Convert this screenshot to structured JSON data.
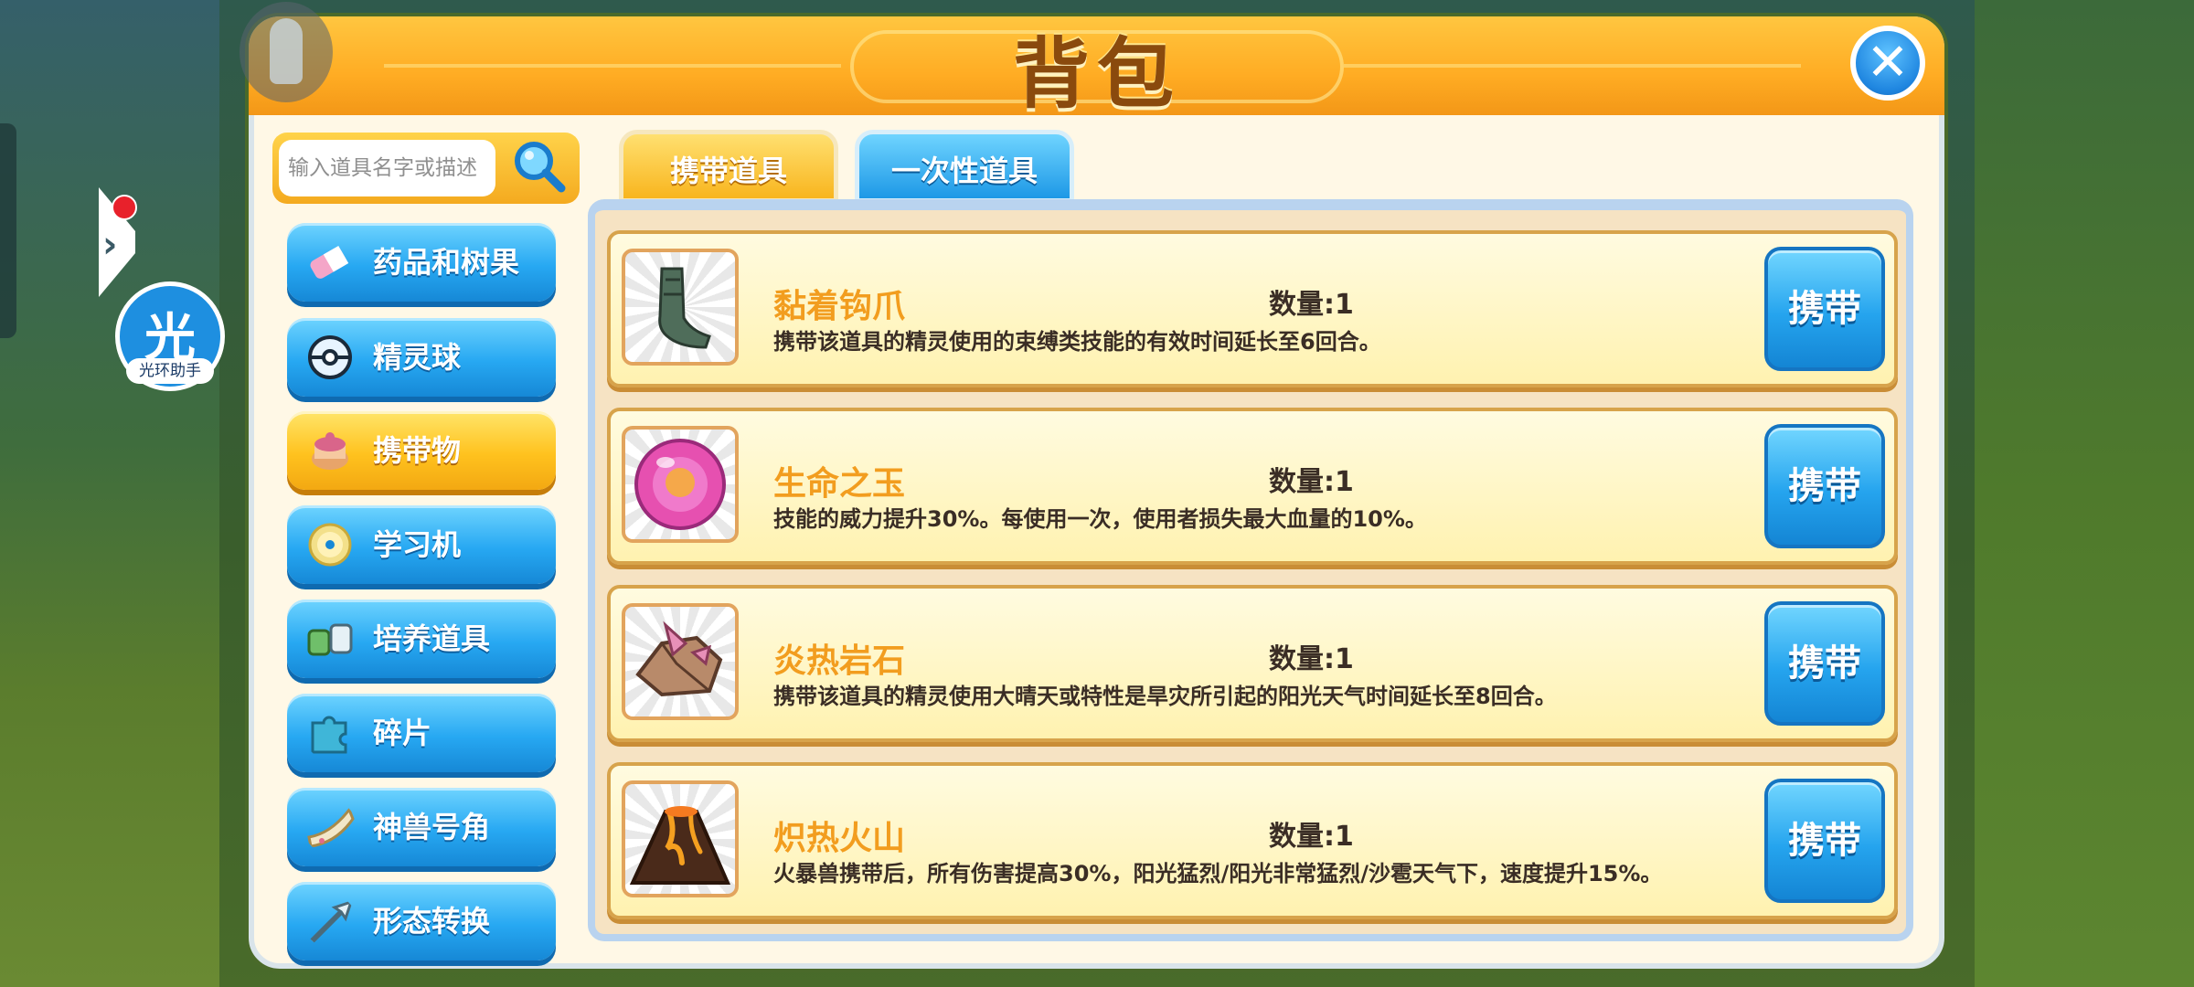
{
  "title": "背包",
  "search": {
    "placeholder": "输入道具名字或描述"
  },
  "halo_assistant": {
    "char": "光",
    "label": "光环助手"
  },
  "tabs": [
    {
      "label": "携带道具",
      "active": true
    },
    {
      "label": "一次性道具",
      "active": false
    }
  ],
  "categories": [
    {
      "label": "药品和树果",
      "icon": "medicine-icon",
      "active": false
    },
    {
      "label": "精灵球",
      "icon": "pokeball-icon",
      "active": false
    },
    {
      "label": "携带物",
      "icon": "held-item-icon",
      "active": true
    },
    {
      "label": "学习机",
      "icon": "disc-icon",
      "active": false
    },
    {
      "label": "培养道具",
      "icon": "training-item-icon",
      "active": false
    },
    {
      "label": "碎片",
      "icon": "puzzle-piece-icon",
      "active": false
    },
    {
      "label": "神兽号角",
      "icon": "horn-icon",
      "active": false
    },
    {
      "label": "形态转换",
      "icon": "arrow-transform-icon",
      "active": false
    }
  ],
  "items": [
    {
      "name": "黏着钩爪",
      "qty": "数量:1",
      "desc": "携带该道具的精灵使用的束缚类技能的有效时间延长至6回合。",
      "icon": "grip-claw-icon",
      "button": "携带"
    },
    {
      "name": "生命之玉",
      "qty": "数量:1",
      "desc": "技能的威力提升30%。每使用一次，使用者损失最大血量的10%。",
      "icon": "life-orb-icon",
      "button": "携带"
    },
    {
      "name": "炎热岩石",
      "qty": "数量:1",
      "desc": "携带该道具的精灵使用大晴天或特性是旱灾所引起的阳光天气时间延长至8回合。",
      "icon": "heat-rock-icon",
      "button": "携带"
    },
    {
      "name": "炽热火山",
      "qty": "数量:1",
      "desc": "火暴兽携带后，所有伤害提高30%，阳光猛烈/阳光非常猛烈/沙雹天气下，速度提升15%。",
      "icon": "volcano-icon",
      "button": "携带"
    }
  ],
  "colors": {
    "accent_orange": "#ffac23",
    "accent_blue": "#1d98e6",
    "item_name": "#f29d1f"
  }
}
